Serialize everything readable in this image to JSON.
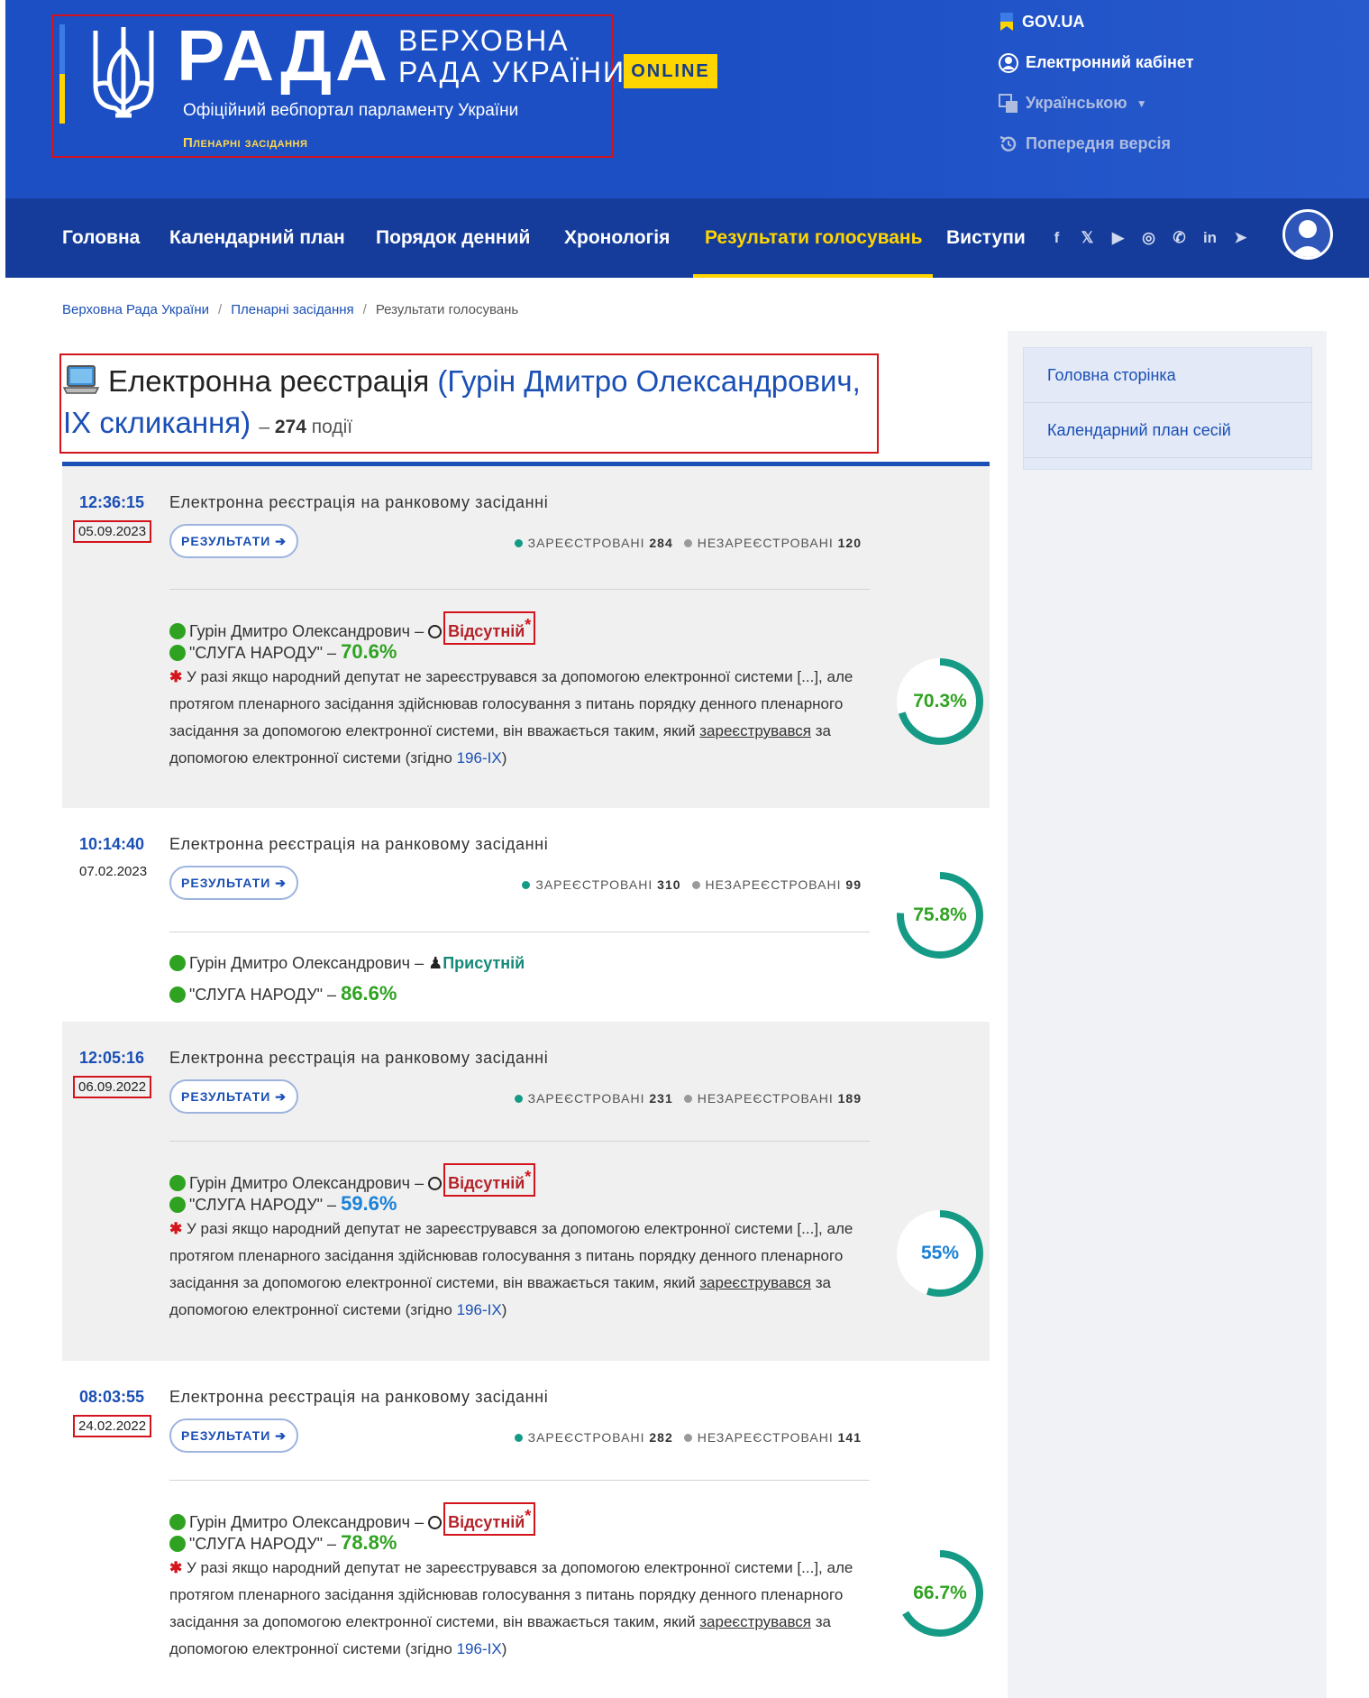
{
  "header": {
    "brand_word": "РАДА",
    "brand_sub_line1": "ВЕРХОВНА",
    "brand_sub_line2": "РАДА УКРАЇНИ",
    "online_badge": "ONLINE",
    "tagline": "Офіційний вебпортал парламенту України",
    "section_link": "Пленарні засідання",
    "top_links": [
      {
        "label": "GOV.UA",
        "icon": "ukraine-flag-icon"
      },
      {
        "label": "Електронний кабінет",
        "icon": "user-circle-icon"
      },
      {
        "label": "Українською",
        "icon": "translate-icon"
      },
      {
        "label": "Попередня версія",
        "icon": "history-icon"
      }
    ],
    "colors": {
      "header_bg": "#1c4fc4",
      "nav_bg": "#153c9a",
      "accent": "#ffd500"
    }
  },
  "nav": {
    "items": [
      "Головна",
      "Календарний план",
      "Порядок денний",
      "Хронологія",
      "Результати голосувань",
      "Виступи"
    ],
    "active": "Результати голосувань",
    "socials": [
      "facebook-icon",
      "x-icon",
      "youtube-icon",
      "instagram-icon",
      "whatsapp-icon",
      "linkedin-icon",
      "telegram-icon"
    ]
  },
  "breadcrumb": [
    "Верховна Рада України",
    "Пленарні засідання",
    "Результати голосувань"
  ],
  "page": {
    "title": "Електронна реєстрація",
    "title_person": "(Гурін Дмитро Олександрович, IX скликання)",
    "dash": "–",
    "count": "274",
    "count_label": "події"
  },
  "sidebar": {
    "items": [
      "Головна сторінка",
      "Календарний план сесій"
    ]
  },
  "common": {
    "result_btn": "РЕЗУЛЬТАТИ",
    "registered_label": "ЗАРЕЄСТРОВАНІ",
    "unregistered_label": "НЕЗАРЕЄСТРОВАНІ",
    "deputy": "Гурін Дмитро Олександрович",
    "faction": "\"СЛУГА НАРОДУ\"",
    "dash": "–",
    "note_part1": "У разі якщо народний депутат не зареєструвався за допомогою електронної системи [...], але протягом пленарного засідання здійснював голосування з питань порядку денного пленарного засідання за допомогою електронної системи, він вважається таким, який",
    "note_underlined": "зареєструвався",
    "note_part2": "за допомогою електронної системи (згідно",
    "note_link": "196-IX",
    "note_end": ")"
  },
  "events": [
    {
      "time": "12:36:15",
      "date": "05.09.2023",
      "name": "Електронна реєстрація на ранковому засіданні",
      "registered": "284",
      "unregistered": "120",
      "status": "Відсутній",
      "faction_pct": "70.6%",
      "ring_pct": 70.3,
      "ring_label": "70.3%"
    },
    {
      "time": "10:14:40",
      "date": "07.02.2023",
      "name": "Електронна реєстрація на ранковому засіданні",
      "registered": "310",
      "unregistered": "99",
      "status": "Присутній",
      "faction_pct": "86.6%",
      "ring_pct": 75.8,
      "ring_label": "75.8%"
    },
    {
      "time": "12:05:16",
      "date": "06.09.2022",
      "name": "Електронна реєстрація на ранковому засіданні",
      "registered": "231",
      "unregistered": "189",
      "status": "Відсутній",
      "faction_pct": "59.6%",
      "ring_pct": 55,
      "ring_label": "55%"
    },
    {
      "time": "08:03:55",
      "date": "24.02.2022",
      "name": "Електронна реєстрація на ранковому засіданні",
      "registered": "282",
      "unregistered": "141",
      "status": "Відсутній",
      "faction_pct": "78.8%",
      "ring_pct": 66.7,
      "ring_label": "66.7%"
    }
  ]
}
